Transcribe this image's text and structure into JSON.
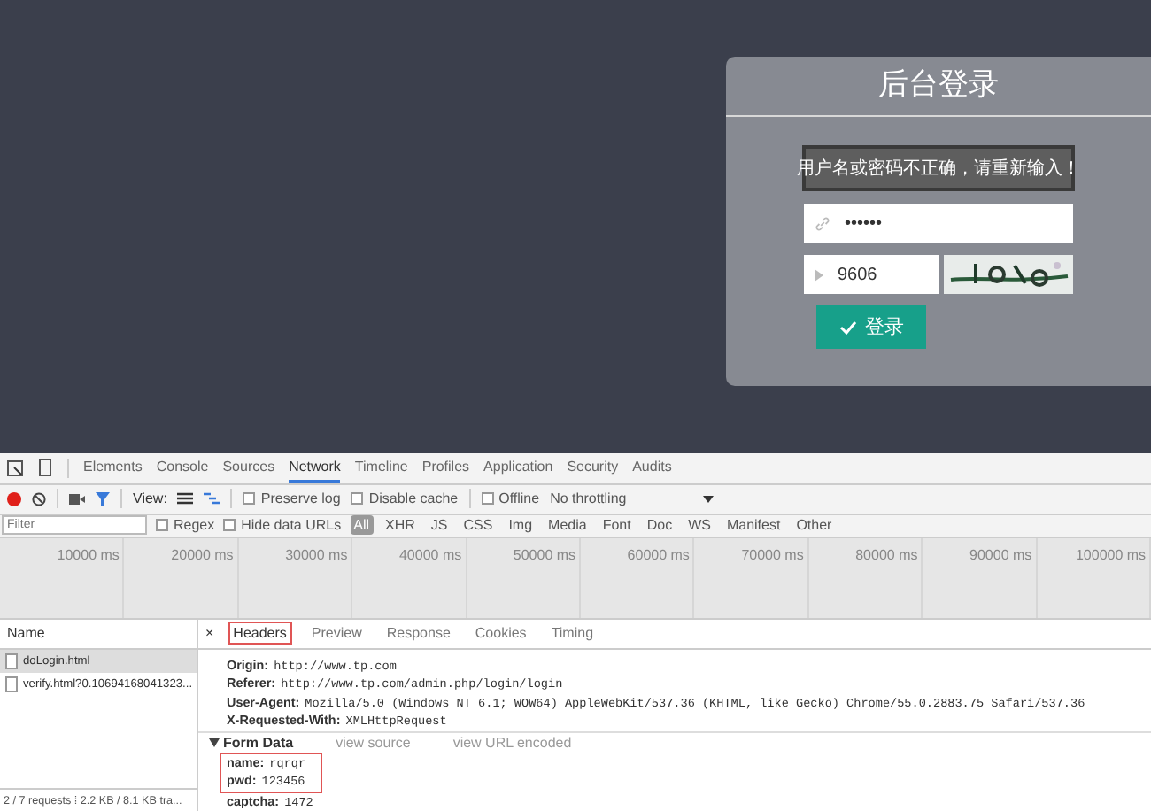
{
  "login": {
    "title": "后台登录",
    "error_message": "用户名或密码不正确，请重新输入！",
    "password_value": "••••••",
    "captcha_value": "9606",
    "submit_label": "登录"
  },
  "devtools": {
    "tabs": [
      {
        "label": "Elements",
        "selected": false
      },
      {
        "label": "Console",
        "selected": false
      },
      {
        "label": "Sources",
        "selected": false
      },
      {
        "label": "Network",
        "selected": true
      },
      {
        "label": "Timeline",
        "selected": false
      },
      {
        "label": "Profiles",
        "selected": false
      },
      {
        "label": "Application",
        "selected": false
      },
      {
        "label": "Security",
        "selected": false
      },
      {
        "label": "Audits",
        "selected": false
      }
    ],
    "toolbar": {
      "view_label": "View:",
      "options": [
        {
          "label": "Preserve log",
          "checked": false
        },
        {
          "label": "Disable cache",
          "checked": false
        },
        {
          "label": "Offline",
          "checked": false
        }
      ],
      "throttling": "No throttling"
    },
    "filter": {
      "placeholder": "Filter",
      "options": [
        {
          "label": "Regex",
          "checked": false
        },
        {
          "label": "Hide data URLs",
          "checked": false
        }
      ],
      "types": [
        {
          "label": "All",
          "selected": true
        },
        {
          "label": "XHR",
          "selected": false
        },
        {
          "label": "JS",
          "selected": false
        },
        {
          "label": "CSS",
          "selected": false
        },
        {
          "label": "Img",
          "selected": false
        },
        {
          "label": "Media",
          "selected": false
        },
        {
          "label": "Font",
          "selected": false
        },
        {
          "label": "Doc",
          "selected": false
        },
        {
          "label": "WS",
          "selected": false
        },
        {
          "label": "Manifest",
          "selected": false
        },
        {
          "label": "Other",
          "selected": false
        }
      ]
    },
    "timeline_ticks": [
      "10000 ms",
      "20000 ms",
      "30000 ms",
      "40000 ms",
      "50000 ms",
      "60000 ms",
      "70000 ms",
      "80000 ms",
      "90000 ms",
      "100000 ms"
    ],
    "requests": {
      "column": "Name",
      "rows": [
        {
          "name": "doLogin.html",
          "selected": true
        },
        {
          "name": "verify.html?0.10694168041323...",
          "selected": false
        }
      ],
      "status": "2 / 7 requests  ⁞  2.2 KB / 8.1 KB tra..."
    },
    "details": {
      "close": "×",
      "tabs": [
        {
          "label": "Headers",
          "selected": true
        },
        {
          "label": "Preview",
          "selected": false
        },
        {
          "label": "Response",
          "selected": false
        },
        {
          "label": "Cookies",
          "selected": false
        },
        {
          "label": "Timing",
          "selected": false
        }
      ],
      "headers": [
        {
          "name": "Origin:",
          "value": "http://www.tp.com"
        },
        {
          "name": "Referer:",
          "value": "http://www.tp.com/admin.php/login/login"
        },
        {
          "name": "User-Agent:",
          "value": "Mozilla/5.0 (Windows NT 6.1; WOW64) AppleWebKit/537.36 (KHTML, like Gecko) Chrome/55.0.2883.75 Safari/537.36"
        },
        {
          "name": "X-Requested-With:",
          "value": "XMLHttpRequest"
        }
      ],
      "form_data": {
        "title": "Form Data",
        "links": [
          "view source",
          "view URL encoded"
        ],
        "fields": [
          {
            "name": "name:",
            "value": "rqrqr",
            "highlighted": true
          },
          {
            "name": "pwd:",
            "value": "123456",
            "highlighted": true
          },
          {
            "name": "captcha:",
            "value": "1472",
            "highlighted": false
          }
        ]
      }
    }
  }
}
